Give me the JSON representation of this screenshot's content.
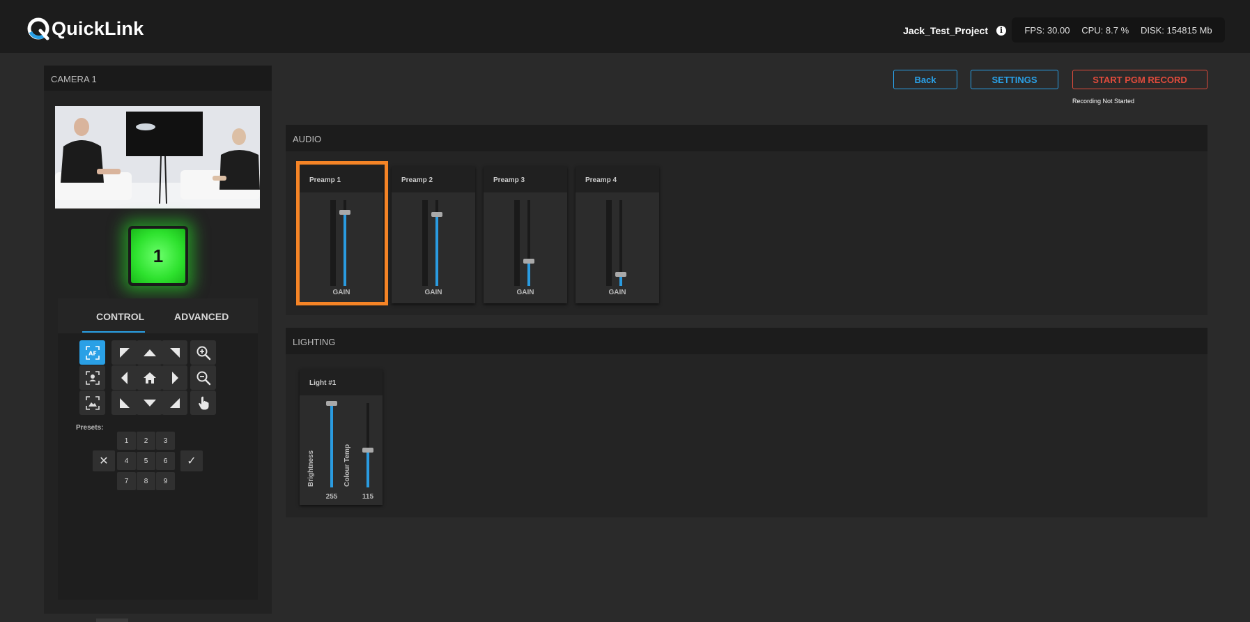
{
  "app": {
    "logo_text": "QuickLink",
    "project_name": "Jack_Test_Project"
  },
  "stats": {
    "fps": "FPS: 30.00",
    "cpu": "CPU: 8.7 %",
    "disk": "DISK: 154815 Mb"
  },
  "camera": {
    "title": "CAMERA 1",
    "tally_number": "1",
    "tally_color": "#2ee22e",
    "tabs": {
      "control": "CONTROL",
      "advanced": "ADVANCED"
    },
    "presets_label": "Presets:",
    "presets": [
      "1",
      "2",
      "3",
      "4",
      "5",
      "6",
      "7",
      "8",
      "9"
    ],
    "af_label": "AF"
  },
  "toolbar": {
    "back_label": "Back",
    "settings_label": "SETTINGS",
    "record_label": "START PGM RECORD",
    "record_status": "Recording Not Started"
  },
  "audio": {
    "title": "AUDIO",
    "channels": [
      {
        "name": "Preamp 1",
        "label": "GAIN",
        "gain_level": 0.86
      },
      {
        "name": "Preamp 2",
        "label": "GAIN",
        "gain_level": 0.84
      },
      {
        "name": "Preamp 3",
        "label": "GAIN",
        "gain_level": 0.29
      },
      {
        "name": "Preamp 4",
        "label": "GAIN",
        "gain_level": 0.14
      }
    ]
  },
  "lighting": {
    "title": "LIGHTING",
    "lights": [
      {
        "name": "Light #1",
        "brightness_label": "Brightness",
        "brightness_value": "255",
        "brightness_level": 1.0,
        "temp_label": "Colour Temp",
        "temp_value": "115",
        "temp_level": 0.45
      }
    ]
  },
  "colors": {
    "accent": "#2aa0e6",
    "record": "#e04b3c",
    "highlight": "#f58426"
  }
}
